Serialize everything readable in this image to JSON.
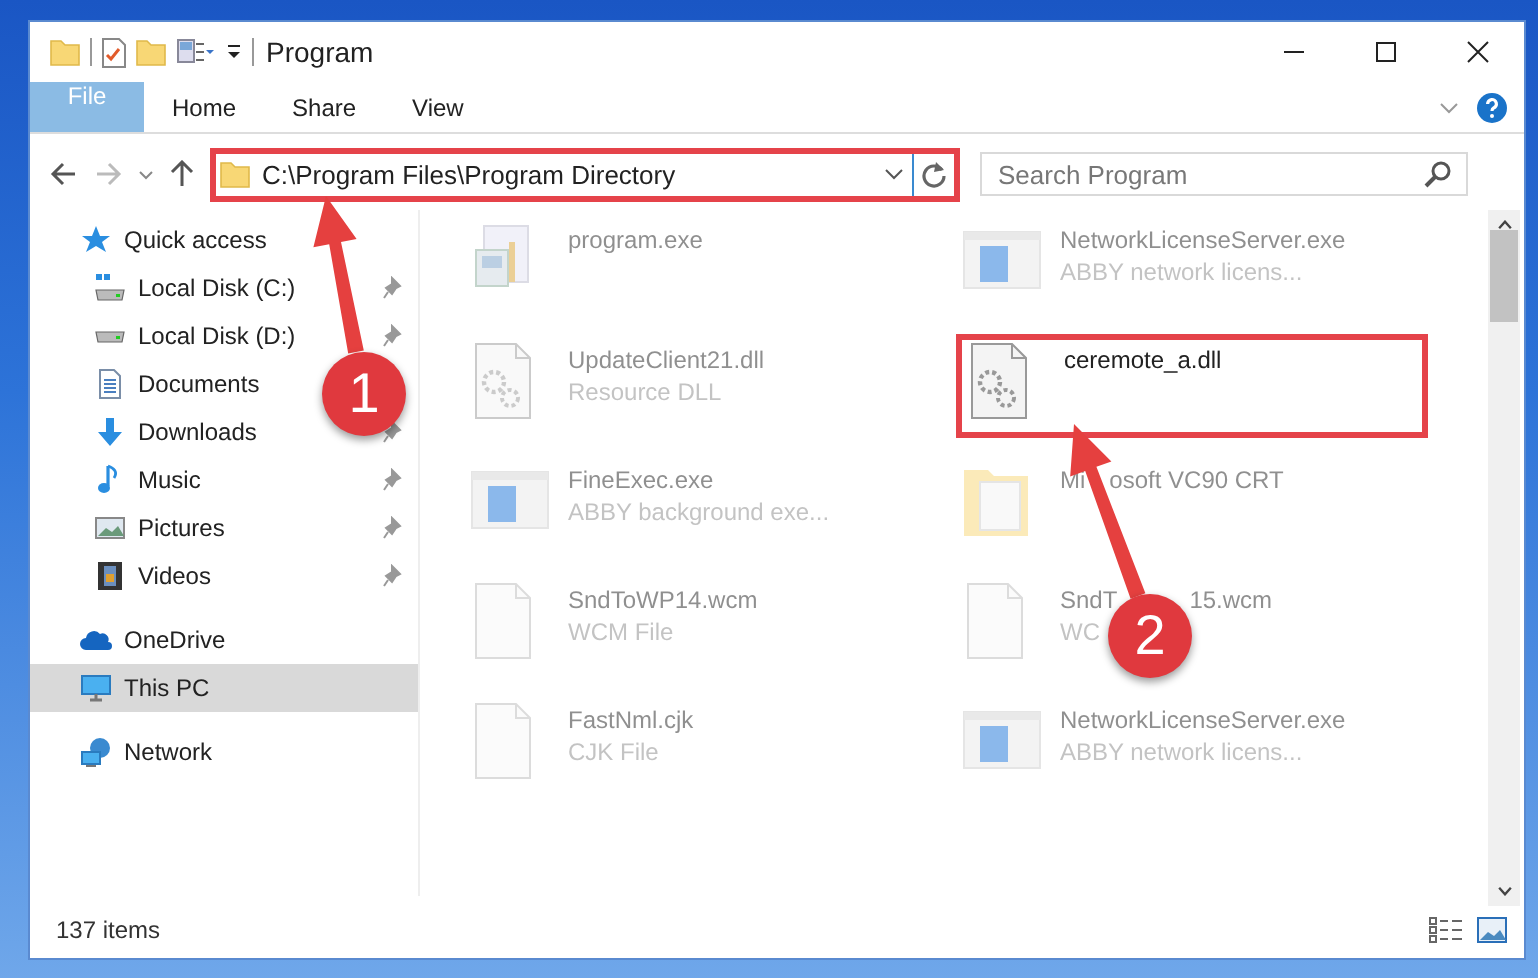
{
  "window": {
    "title": "Program"
  },
  "ribbon_tabs": [
    {
      "label": "File",
      "kind": "file_menu"
    },
    {
      "label": "Home",
      "kind": "tab"
    },
    {
      "label": "Share",
      "kind": "tab"
    },
    {
      "label": "View",
      "kind": "tab"
    }
  ],
  "address": {
    "path": "C:\\Program Files\\Program Directory",
    "highlighted": true
  },
  "search": {
    "placeholder": "Search Program"
  },
  "sidebar": {
    "items": [
      {
        "label": "Quick access",
        "selected": false,
        "children": [
          {
            "label": "Local Disk (C:)",
            "pinned": true,
            "selected": false
          },
          {
            "label": "Local Disk (D:)",
            "pinned": true,
            "selected": false
          },
          {
            "label": "Documents",
            "selected": false
          },
          {
            "label": "Downloads",
            "pinned": true,
            "selected": false
          },
          {
            "label": "Music",
            "pinned": true,
            "selected": false
          },
          {
            "label": "Pictures",
            "pinned": true,
            "selected": false
          },
          {
            "label": "Videos",
            "pinned": true,
            "selected": false
          }
        ]
      },
      {
        "label": "OneDrive",
        "selected": false
      },
      {
        "label": "This PC",
        "selected": true
      },
      {
        "label": "Network",
        "selected": false
      }
    ]
  },
  "files": [
    {
      "name_parts": [
        "program.exe"
      ],
      "kind": "installer",
      "highlighted": false
    },
    {
      "name_parts": [
        "NetworkLicenseServer.exe"
      ],
      "description": "ABBY network licens...",
      "kind": "app",
      "highlighted": false
    },
    {
      "name_parts": [
        "UpdateClient21.dll"
      ],
      "description": "Resource DLL",
      "kind": "dll",
      "highlighted": false
    },
    {
      "name_parts": [
        "ceremote_a.dll"
      ],
      "kind": "dll",
      "highlighted": true
    },
    {
      "name_parts": [
        "FineExec.exe"
      ],
      "description": "ABBY background exe...",
      "kind": "app",
      "highlighted": false
    },
    {
      "name_parts": [
        "Mi",
        "osoft VC90 CRT"
      ],
      "kind": "folder",
      "highlighted": false
    },
    {
      "name_parts": [
        "SndToWP14.wcm"
      ],
      "description": "WCM File",
      "kind": "file",
      "highlighted": false
    },
    {
      "name_parts": [
        "SndT",
        "15.wcm"
      ],
      "description": "WC",
      "kind": "file",
      "highlighted": false
    },
    {
      "name_parts": [
        "FastNml.cjk"
      ],
      "description": "CJK File",
      "kind": "file",
      "highlighted": false
    },
    {
      "name_parts": [
        "NetworkLicenseServer.exe"
      ],
      "description": "ABBY network licens...",
      "kind": "app",
      "highlighted": false
    }
  ],
  "status_bar": {
    "item_count": "137 items"
  },
  "annotations": [
    {
      "label": "1"
    },
    {
      "label": "2"
    }
  ]
}
